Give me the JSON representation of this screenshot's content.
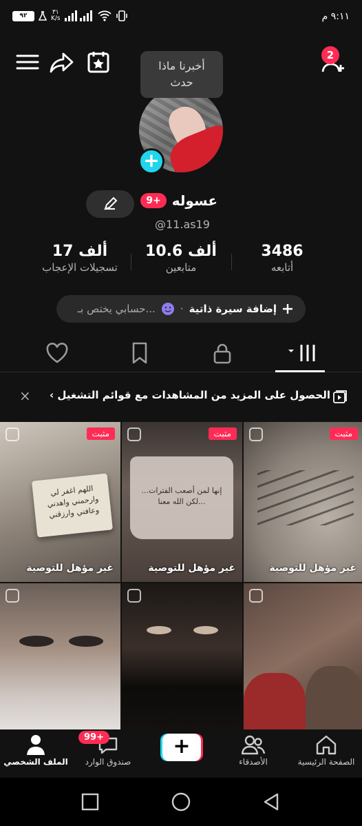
{
  "status_bar": {
    "time": "٩:١١ م",
    "battery": "٩٢",
    "net_speed_value": "٣١",
    "net_speed_unit": "K/s"
  },
  "tooltip": {
    "line1": "أخبرنا ماذا",
    "line2": "حدث"
  },
  "add_friend_badge": "2",
  "profile": {
    "name": "عسوله",
    "badge": "9+",
    "handle": "@11.as19"
  },
  "stats": [
    {
      "value": "3486",
      "label": "أتابعه"
    },
    {
      "value": "10.6 ألف",
      "label": "متابعين"
    },
    {
      "value": "17 ألف",
      "label": "تسجيلات الإعجاب"
    }
  ],
  "bio": {
    "add_label": "إضافة سيرة ذاتية",
    "dot": "·",
    "hint": "حسابي يختص بـ..."
  },
  "banner": {
    "text": "الحصول على المزيد من المشاهدات مع قوائم التشغيل ›",
    "close": "×"
  },
  "videos": [
    {
      "pinned": "مثبت",
      "caption": "غير مؤهل للتوصية",
      "overlay_text": ""
    },
    {
      "pinned": "مثبت",
      "caption": "غير مؤهل للتوصية",
      "overlay_text": "إنها لمن أصعب الفترات... لكن الله معنا..."
    },
    {
      "pinned": "مثبت",
      "caption": "غير مؤهل للتوصية",
      "overlay_text": "اللهم اغفر لي وارحمني واهدني وعافني وارزقني"
    },
    {
      "pinned": "",
      "caption": "",
      "overlay_text": ""
    },
    {
      "pinned": "",
      "caption": "",
      "overlay_text": ""
    },
    {
      "pinned": "",
      "caption": "",
      "overlay_text": ""
    }
  ],
  "bottom_nav": {
    "home": "الصفحة الرئيسية",
    "friends": "الأصدقاء",
    "inbox": "صندوق الوارد",
    "inbox_badge": "99+",
    "profile": "الملف الشخصي",
    "create": "+"
  },
  "colors": {
    "accent": "#fe2c55",
    "cyan": "#20d5ec",
    "background": "#121212"
  }
}
